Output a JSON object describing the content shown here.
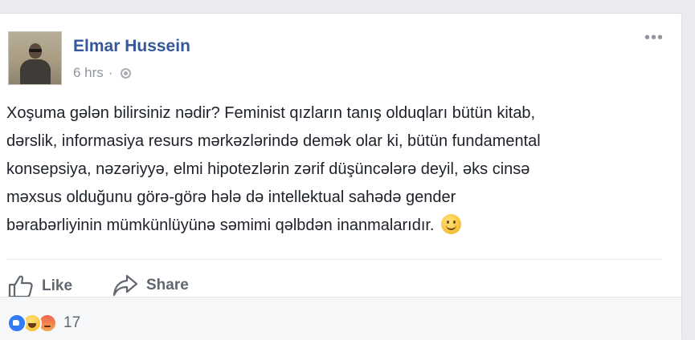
{
  "post": {
    "author": "Elmar Hussein",
    "time": "6 hrs",
    "separator": "·",
    "privacy_icon": "globe-icon",
    "more_label": "•••",
    "text_lines": [
      "Xoşuma gələn bilirsiniz nədir? Feminist qızların tanış olduqları bütün kitab,",
      "dərslik, informasiya resurs mərkəzlərində demək olar ki, bütün fundamental",
      "konsepsiya, nəzəriyyə, elmi hipotezlərin zərif düşüncələrə deyil, əks cinsə",
      "məxsus olduğunu görə-görə hələ də intellektual sahədə gender",
      "bərabərliyinin mümkünlüyünə səmimi qəlbdən inanmalarıdır."
    ],
    "emoji": "smile-emoji"
  },
  "actions": {
    "like_label": "Like",
    "share_label": "Share"
  },
  "reactions": {
    "types": [
      "like",
      "haha",
      "angry"
    ],
    "count": "17"
  },
  "colors": {
    "author_blue": "#365899",
    "meta_gray": "#90949c",
    "action_gray": "#606770",
    "like_blue": "#2f7cf6"
  }
}
